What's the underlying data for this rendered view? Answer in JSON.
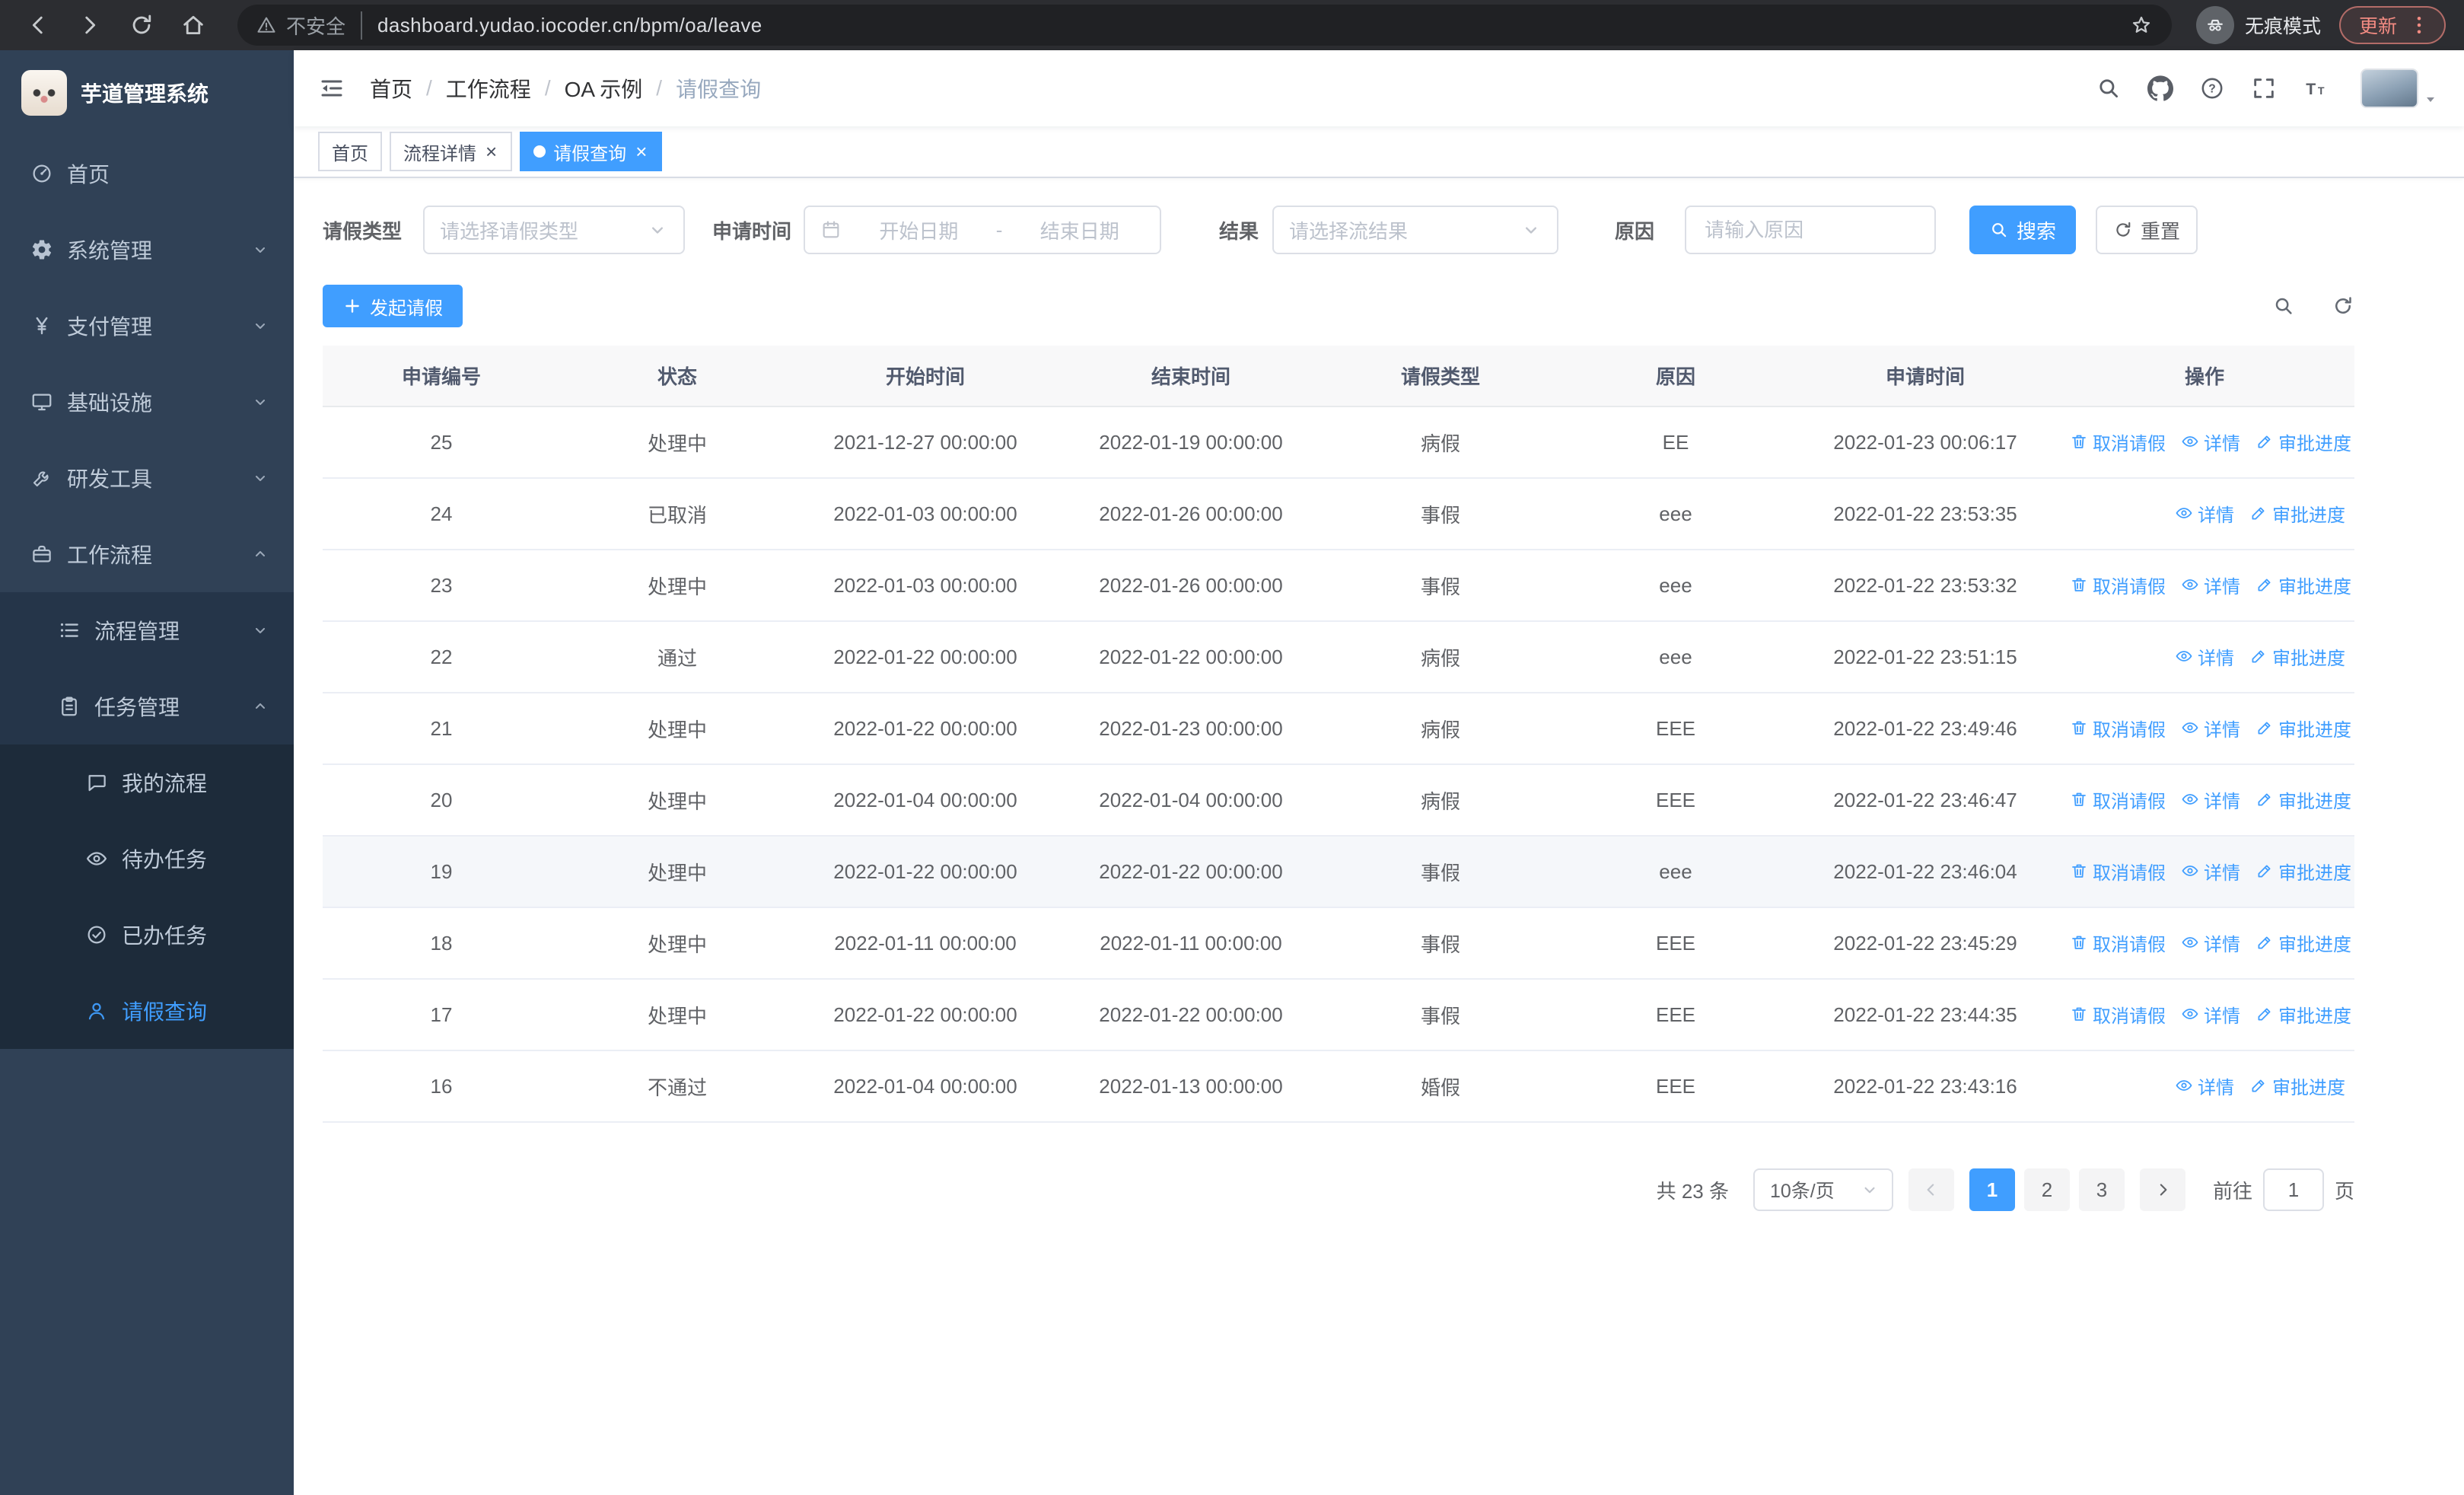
{
  "colors": {
    "accent": "#409eff",
    "sidebar_bg": "#304156",
    "update_red": "#f28b82"
  },
  "browser": {
    "security_warning": "不安全",
    "url": "dashboard.yudao.iocoder.cn/bpm/oa/leave",
    "incognito_label": "无痕模式",
    "update_label": "更新"
  },
  "sidebar": {
    "logo_title": "芋道管理系统",
    "items": [
      {
        "name": "home",
        "label": "首页",
        "icon": "gauge",
        "level": 1
      },
      {
        "name": "system",
        "label": "系统管理",
        "icon": "gear",
        "level": 1,
        "arrow": "down"
      },
      {
        "name": "payment",
        "label": "支付管理",
        "icon": "yen",
        "level": 1,
        "arrow": "down"
      },
      {
        "name": "infra",
        "label": "基础设施",
        "icon": "monitor",
        "level": 1,
        "arrow": "down"
      },
      {
        "name": "devtools",
        "label": "研发工具",
        "icon": "tools",
        "level": 1,
        "arrow": "down"
      },
      {
        "name": "workflow",
        "label": "工作流程",
        "icon": "case",
        "level": 1,
        "arrow": "up"
      },
      {
        "name": "process-mgmt",
        "label": "流程管理",
        "icon": "list",
        "level": 2,
        "arrow": "down"
      },
      {
        "name": "task-mgmt",
        "label": "任务管理",
        "icon": "clip",
        "level": 2,
        "arrow": "up"
      },
      {
        "name": "my-process",
        "label": "我的流程",
        "icon": "chat",
        "level": 3
      },
      {
        "name": "todo-tasks",
        "label": "待办任务",
        "icon": "eye",
        "level": 3
      },
      {
        "name": "done-tasks",
        "label": "已办任务",
        "icon": "check",
        "level": 3
      },
      {
        "name": "leave-query",
        "label": "请假查询",
        "icon": "user",
        "level": 3,
        "active": true
      }
    ]
  },
  "header": {
    "breadcrumb": [
      "首页",
      "工作流程",
      "OA 示例",
      "请假查询"
    ],
    "breadcrumb_separator": "/"
  },
  "tabs": {
    "items": [
      {
        "label": "首页",
        "closable": false
      },
      {
        "label": "流程详情",
        "closable": true
      },
      {
        "label": "请假查询",
        "closable": true,
        "active": true
      }
    ]
  },
  "filters": {
    "leave_type": {
      "label": "请假类型",
      "placeholder": "请选择请假类型"
    },
    "apply_time": {
      "label": "申请时间",
      "start_placeholder": "开始日期",
      "separator": "-",
      "end_placeholder": "结束日期"
    },
    "result": {
      "label": "结果",
      "placeholder": "请选择流结果"
    },
    "reason": {
      "label": "原因",
      "placeholder": "请输入原因"
    },
    "search_label": "搜索",
    "reset_label": "重置"
  },
  "toolbar": {
    "create_label": "发起请假"
  },
  "table": {
    "columns": [
      "申请编号",
      "状态",
      "开始时间",
      "结束时间",
      "请假类型",
      "原因",
      "申请时间",
      "操作"
    ],
    "action_labels": {
      "cancel": "取消请假",
      "detail": "详情",
      "progress": "审批进度"
    },
    "rows": [
      {
        "id": "25",
        "status": "处理中",
        "start": "2021-12-27 00:00:00",
        "end": "2022-01-19 00:00:00",
        "type": "病假",
        "reason": "EE",
        "applied": "2022-01-23 00:06:17",
        "actions": [
          "cancel",
          "detail",
          "progress"
        ]
      },
      {
        "id": "24",
        "status": "已取消",
        "start": "2022-01-03 00:00:00",
        "end": "2022-01-26 00:00:00",
        "type": "事假",
        "reason": "eee",
        "applied": "2022-01-22 23:53:35",
        "actions": [
          "detail",
          "progress"
        ]
      },
      {
        "id": "23",
        "status": "处理中",
        "start": "2022-01-03 00:00:00",
        "end": "2022-01-26 00:00:00",
        "type": "事假",
        "reason": "eee",
        "applied": "2022-01-22 23:53:32",
        "actions": [
          "cancel",
          "detail",
          "progress"
        ]
      },
      {
        "id": "22",
        "status": "通过",
        "start": "2022-01-22 00:00:00",
        "end": "2022-01-22 00:00:00",
        "type": "病假",
        "reason": "eee",
        "applied": "2022-01-22 23:51:15",
        "actions": [
          "detail",
          "progress"
        ]
      },
      {
        "id": "21",
        "status": "处理中",
        "start": "2022-01-22 00:00:00",
        "end": "2022-01-23 00:00:00",
        "type": "病假",
        "reason": "EEE",
        "applied": "2022-01-22 23:49:46",
        "actions": [
          "cancel",
          "detail",
          "progress"
        ]
      },
      {
        "id": "20",
        "status": "处理中",
        "start": "2022-01-04 00:00:00",
        "end": "2022-01-04 00:00:00",
        "type": "病假",
        "reason": "EEE",
        "applied": "2022-01-22 23:46:47",
        "actions": [
          "cancel",
          "detail",
          "progress"
        ]
      },
      {
        "id": "19",
        "status": "处理中",
        "start": "2022-01-22 00:00:00",
        "end": "2022-01-22 00:00:00",
        "type": "事假",
        "reason": "eee",
        "applied": "2022-01-22 23:46:04",
        "actions": [
          "cancel",
          "detail",
          "progress"
        ],
        "highlighted": true
      },
      {
        "id": "18",
        "status": "处理中",
        "start": "2022-01-11 00:00:00",
        "end": "2022-01-11 00:00:00",
        "type": "事假",
        "reason": "EEE",
        "applied": "2022-01-22 23:45:29",
        "actions": [
          "cancel",
          "detail",
          "progress"
        ]
      },
      {
        "id": "17",
        "status": "处理中",
        "start": "2022-01-22 00:00:00",
        "end": "2022-01-22 00:00:00",
        "type": "事假",
        "reason": "EEE",
        "applied": "2022-01-22 23:44:35",
        "actions": [
          "cancel",
          "detail",
          "progress"
        ]
      },
      {
        "id": "16",
        "status": "不通过",
        "start": "2022-01-04 00:00:00",
        "end": "2022-01-13 00:00:00",
        "type": "婚假",
        "reason": "EEE",
        "applied": "2022-01-22 23:43:16",
        "actions": [
          "detail",
          "progress"
        ]
      }
    ]
  },
  "pagination": {
    "total_text": "共 23 条",
    "page_size": "10条/页",
    "pages": [
      {
        "label": "1",
        "active": true
      },
      {
        "label": "2"
      },
      {
        "label": "3"
      }
    ],
    "goto_label": "前往",
    "goto_value": "1",
    "goto_suffix": "页"
  }
}
